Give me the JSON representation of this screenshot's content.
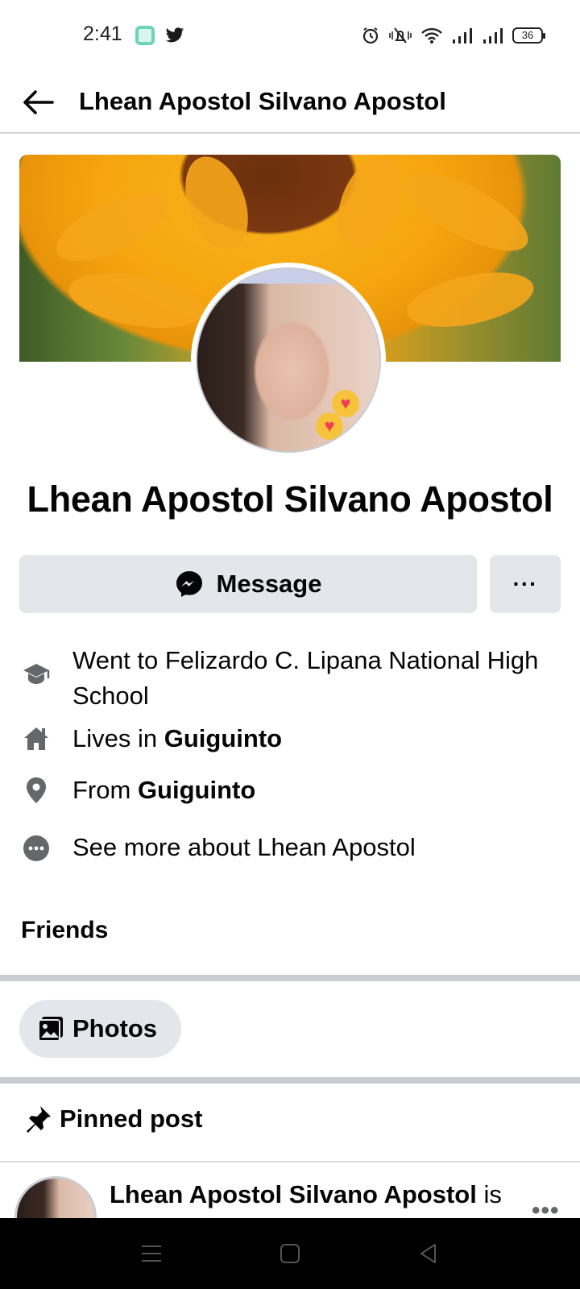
{
  "status_bar": {
    "time": "2:41",
    "battery": "36",
    "icons": [
      "app-notification-icon",
      "twitter-icon",
      "alarm-icon",
      "vibrate-icon",
      "wifi-icon",
      "signal-icon",
      "signal-icon",
      "battery-icon"
    ]
  },
  "header": {
    "title": "Lhean Apostol Silvano Apostol",
    "back_icon": "arrow-left-icon"
  },
  "profile": {
    "name": "Lhean Apostol Silvano Apostol",
    "message_label": "Message",
    "more_label": "···"
  },
  "intro": {
    "education": "Went to Felizardo C. Lipana National High School",
    "lives_prefix": "Lives in ",
    "lives_place": "Guiguinto",
    "from_prefix": "From ",
    "from_place": "Guiguinto",
    "see_more": "See more about Lhean Apostol"
  },
  "sections": {
    "friends_title": "Friends",
    "photos_label": "Photos",
    "pinned_label": "Pinned post"
  },
  "post": {
    "author": "Lhean Apostol Silvano Apostol",
    "suffix": " is",
    "more": "•••"
  },
  "colors": {
    "chip_bg": "#e4e6eb",
    "divider": "#c9ccd1",
    "text": "#050505",
    "nav_bar": "#000000"
  }
}
